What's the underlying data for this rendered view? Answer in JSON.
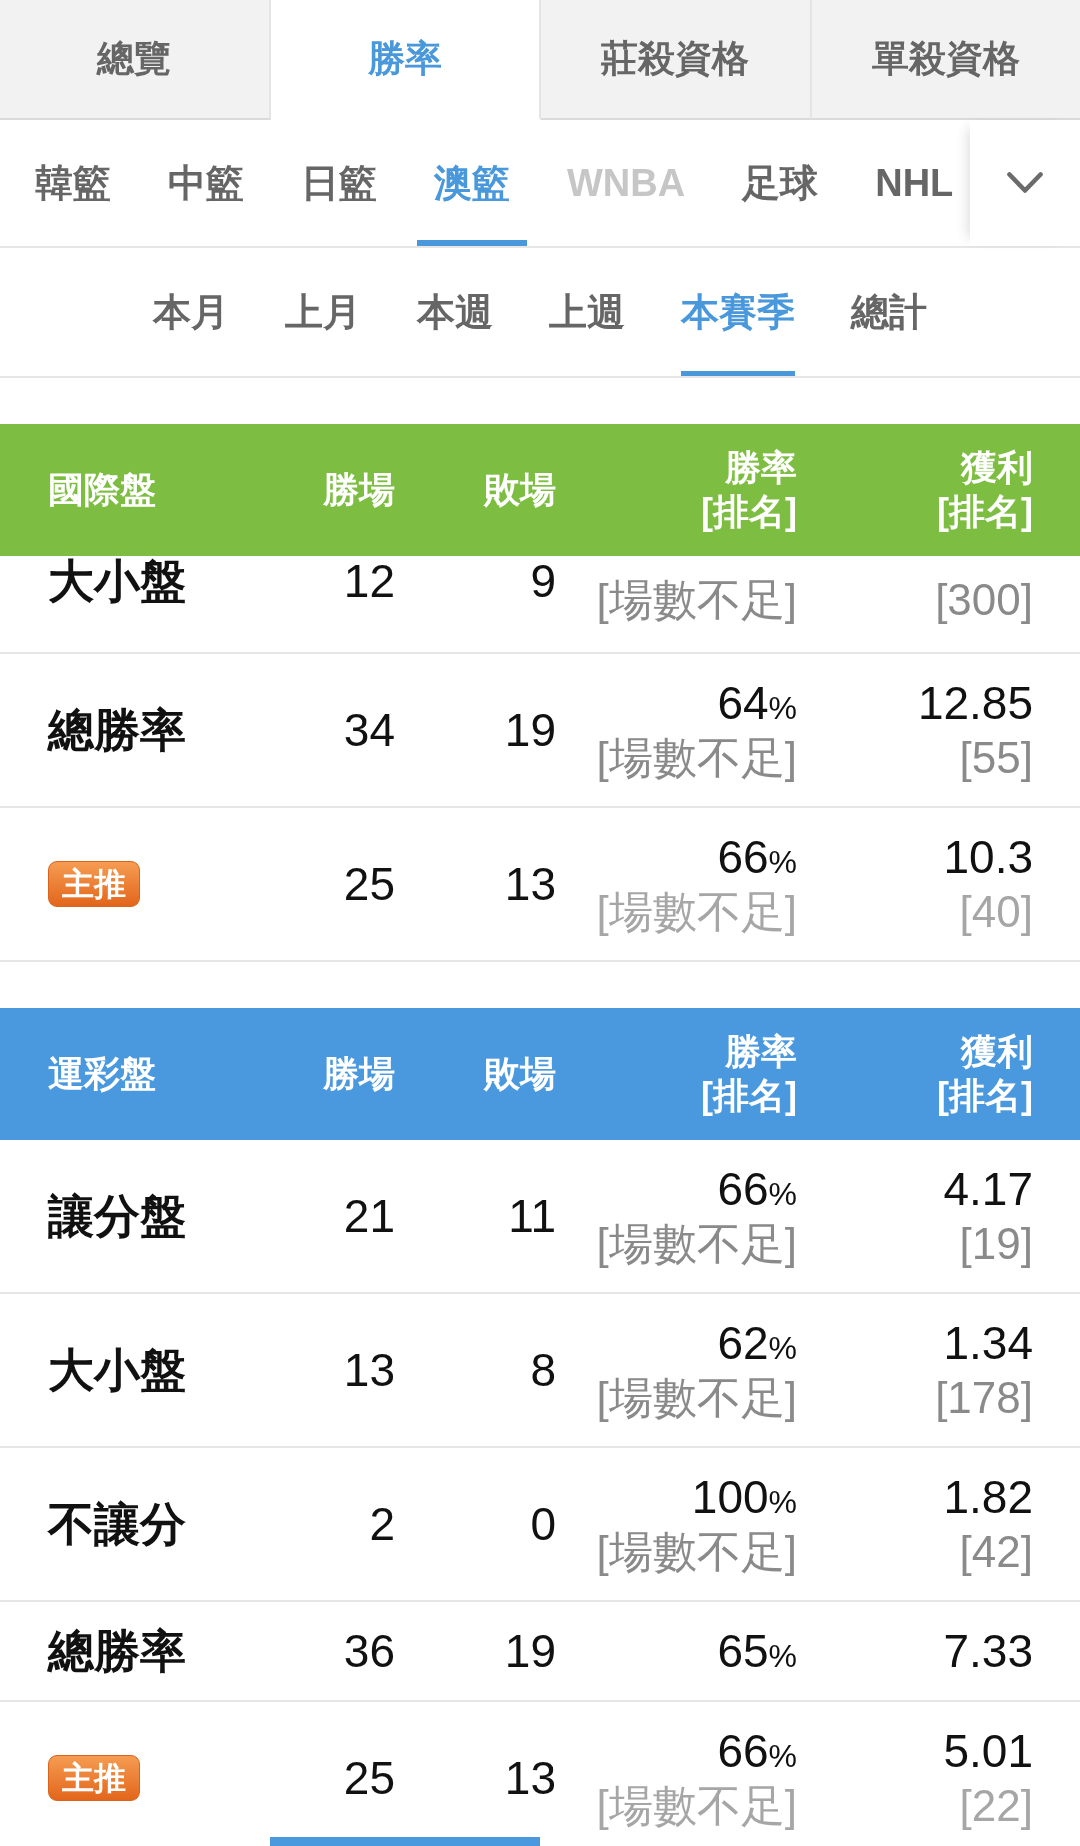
{
  "tabs": [
    {
      "label": "總覽",
      "selected": false
    },
    {
      "label": "勝率",
      "selected": true
    },
    {
      "label": "莊殺資格",
      "selected": false
    },
    {
      "label": "單殺資格",
      "selected": false
    }
  ],
  "leagues": [
    {
      "label": "韓籃",
      "selected": false,
      "disabled": false
    },
    {
      "label": "中籃",
      "selected": false,
      "disabled": false
    },
    {
      "label": "日籃",
      "selected": false,
      "disabled": false
    },
    {
      "label": "澳籃",
      "selected": true,
      "disabled": false
    },
    {
      "label": "WNBA",
      "selected": false,
      "disabled": true
    },
    {
      "label": "足球",
      "selected": false,
      "disabled": false
    },
    {
      "label": "NHL",
      "selected": false,
      "disabled": false
    }
  ],
  "periods": [
    {
      "label": "本月",
      "selected": false
    },
    {
      "label": "上月",
      "selected": false
    },
    {
      "label": "本週",
      "selected": false
    },
    {
      "label": "上週",
      "selected": false
    },
    {
      "label": "本賽季",
      "selected": true
    },
    {
      "label": "總計",
      "selected": false
    }
  ],
  "tables": [
    {
      "color": "#7dbd41",
      "columns": [
        {
          "label": "國際盤"
        },
        {
          "label": "勝場"
        },
        {
          "label": "敗場"
        },
        {
          "label": "勝率",
          "sub": "[排名]"
        },
        {
          "label": "獲利",
          "sub": "[排名]"
        }
      ],
      "rows": [
        {
          "kind": "label",
          "label": "大小盤",
          "wins": "12",
          "losses": "9",
          "rate_rank": "[場數不足]",
          "profit_rank": "[300]"
        },
        {
          "kind": "label",
          "label": "總勝率",
          "wins": "34",
          "losses": "19",
          "rate": "64",
          "pct": "%",
          "rate_rank": "[場數不足]",
          "profit": "12.85",
          "profit_rank": "[55]"
        },
        {
          "kind": "badge",
          "label": "主推",
          "wins": "25",
          "losses": "13",
          "rate": "66",
          "pct": "%",
          "rate_rank": "[場數不足]",
          "profit": "10.3",
          "profit_rank": "[40]"
        }
      ]
    },
    {
      "color": "#4a98dd",
      "columns": [
        {
          "label": "運彩盤"
        },
        {
          "label": "勝場"
        },
        {
          "label": "敗場"
        },
        {
          "label": "勝率",
          "sub": "[排名]"
        },
        {
          "label": "獲利",
          "sub": "[排名]"
        }
      ],
      "rows": [
        {
          "kind": "label",
          "label": "讓分盤",
          "wins": "21",
          "losses": "11",
          "rate": "66",
          "pct": "%",
          "rate_rank": "[場數不足]",
          "profit": "4.17",
          "profit_rank": "[19]"
        },
        {
          "kind": "label",
          "label": "大小盤",
          "wins": "13",
          "losses": "8",
          "rate": "62",
          "pct": "%",
          "rate_rank": "[場數不足]",
          "profit": "1.34",
          "profit_rank": "[178]"
        },
        {
          "kind": "label",
          "label": "不讓分",
          "wins": "2",
          "losses": "0",
          "rate": "100",
          "pct": "%",
          "rate_rank": "[場數不足]",
          "profit": "1.82",
          "profit_rank": "[42]"
        },
        {
          "kind": "label",
          "label": "總勝率",
          "wins": "36",
          "losses": "19",
          "rate": "65",
          "pct": "%",
          "profit": "7.33"
        },
        {
          "kind": "badge",
          "label": "主推",
          "wins": "25",
          "losses": "13",
          "rate": "66",
          "pct": "%",
          "rate_rank": "[場數不足]",
          "profit": "5.01",
          "profit_rank": "[22]"
        }
      ]
    }
  ]
}
